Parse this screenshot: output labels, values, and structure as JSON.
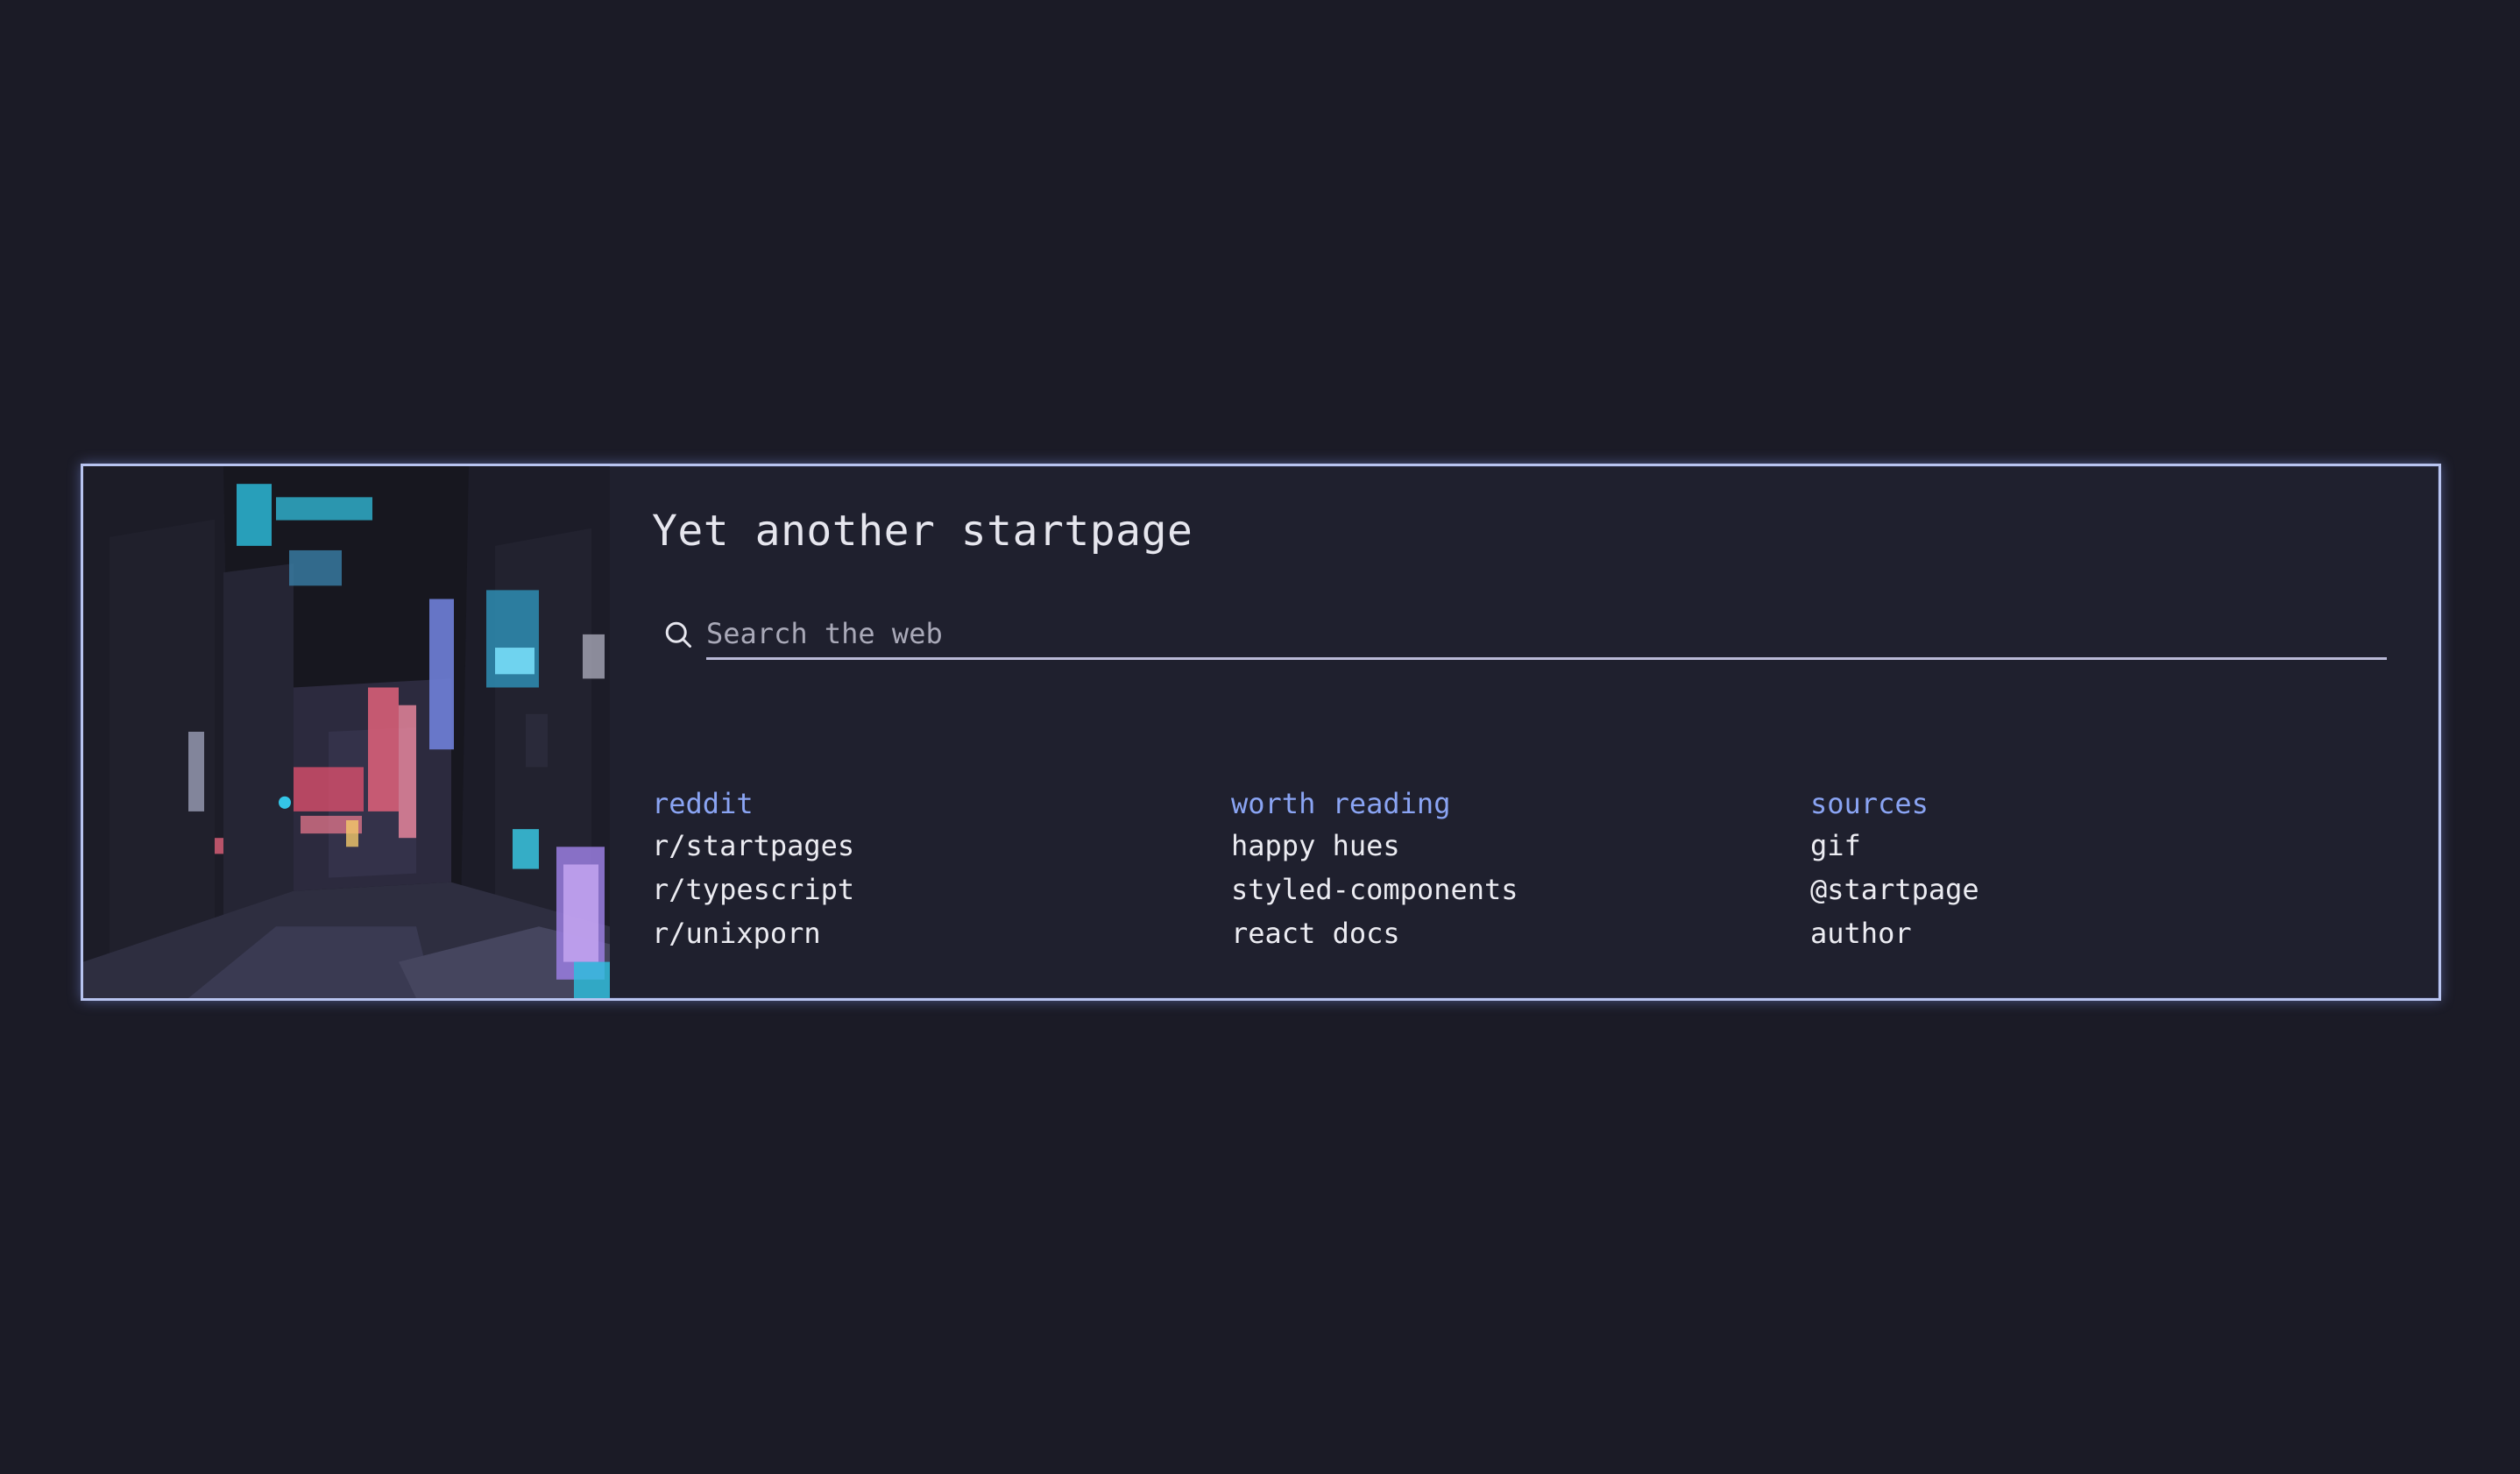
{
  "page": {
    "title": "Yet another startpage",
    "accent_color": "#8aa4f3",
    "border_color": "#b8c4f0",
    "background_color": "#1b1b26"
  },
  "search": {
    "placeholder": "Search the web",
    "icon": "search-icon"
  },
  "banner": {
    "description_icon": "city-alley-illustration"
  },
  "columns": [
    {
      "title": "reddit",
      "links": [
        "r/startpages",
        "r/typescript",
        "r/unixporn"
      ]
    },
    {
      "title": "worth reading",
      "links": [
        "happy hues",
        "styled-components",
        "react docs"
      ]
    },
    {
      "title": "sources",
      "links": [
        "gif",
        "@startpage",
        "author"
      ]
    }
  ]
}
